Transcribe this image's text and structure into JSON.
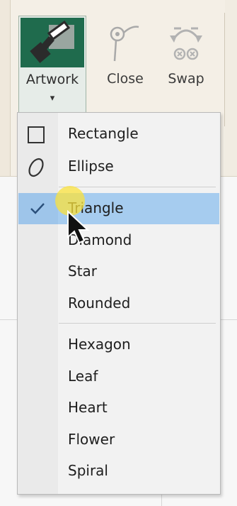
{
  "ribbon": {
    "artwork_label": "Artwork",
    "artwork_caret": "▾",
    "close_label": "Close",
    "swap_label": "Swap"
  },
  "menu": {
    "items": [
      {
        "label": "Rectangle",
        "icon": "rectangle-icon"
      },
      {
        "label": "Ellipse",
        "icon": "ellipse-icon"
      },
      {
        "label": "Triangle",
        "icon": "check-icon",
        "selected": true
      },
      {
        "label": "Diamond"
      },
      {
        "label": "Star"
      },
      {
        "label": "Rounded"
      },
      {
        "label": "Hexagon"
      },
      {
        "label": "Leaf"
      },
      {
        "label": "Heart"
      },
      {
        "label": "Flower"
      },
      {
        "label": "Spiral"
      }
    ]
  },
  "colors": {
    "accent_green": "#1f6b4d",
    "selection": "#a6ccef",
    "cursor_highlight": "#fae13c"
  }
}
